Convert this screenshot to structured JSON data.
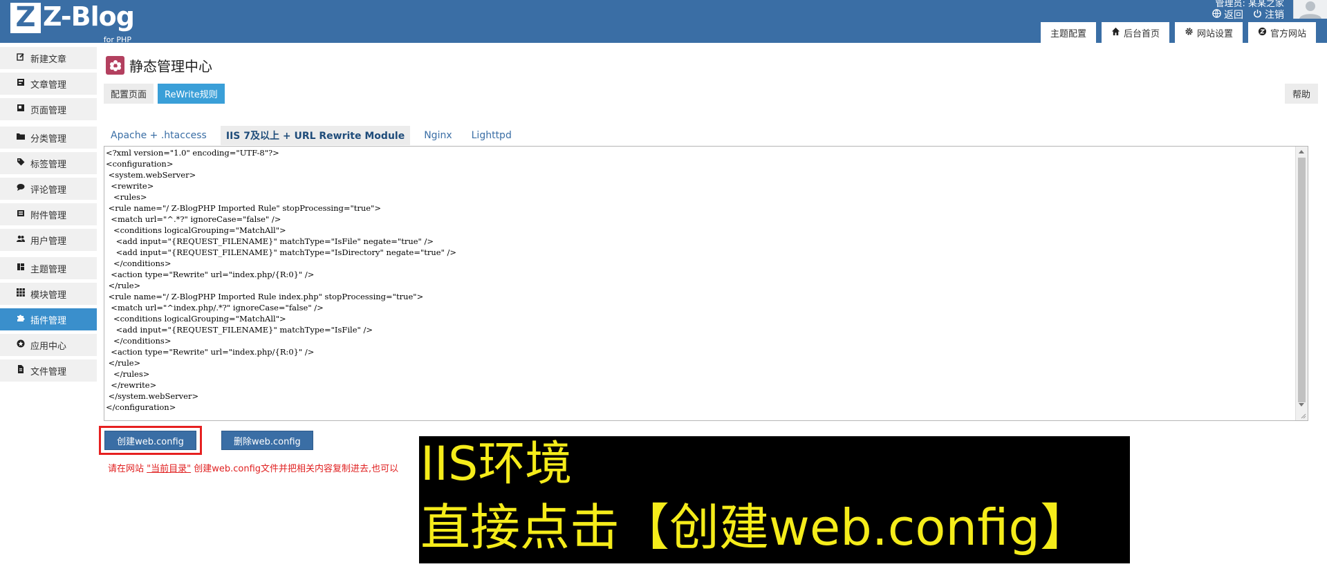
{
  "header": {
    "logo_letter": "Z",
    "logo_text": "Z-Blog",
    "logo_sub": "for PHP",
    "admin_label": "管理员: 某某之家",
    "links": [
      {
        "label": "返回",
        "icon": "globe-icon"
      },
      {
        "label": "注销",
        "icon": "power-icon"
      }
    ],
    "nav_tabs": [
      {
        "label": "主题配置",
        "icon": ""
      },
      {
        "label": "后台首页",
        "icon": "home-icon"
      },
      {
        "label": "网站设置",
        "icon": "gear-icon"
      },
      {
        "label": "官方网站",
        "icon": "zblog-icon"
      }
    ]
  },
  "sidebar": {
    "items": [
      {
        "label": "新建文章",
        "icon": "edit-icon"
      },
      {
        "label": "文章管理",
        "icon": "article-icon"
      },
      {
        "label": "页面管理",
        "icon": "page-icon"
      },
      {
        "label": "分类管理",
        "icon": "folder-icon"
      },
      {
        "label": "标签管理",
        "icon": "tag-icon"
      },
      {
        "label": "评论管理",
        "icon": "comment-icon"
      },
      {
        "label": "附件管理",
        "icon": "attachment-icon"
      },
      {
        "label": "用户管理",
        "icon": "users-icon"
      },
      {
        "label": "主题管理",
        "icon": "theme-icon"
      },
      {
        "label": "模块管理",
        "icon": "grid-icon"
      },
      {
        "label": "插件管理",
        "icon": "puzzle-icon",
        "active": true
      },
      {
        "label": "应用中心",
        "icon": "app-center-icon"
      },
      {
        "label": "文件管理",
        "icon": "file-icon"
      }
    ]
  },
  "main": {
    "title": "静态管理中心",
    "subtabs": [
      {
        "label": "配置页面",
        "active": false
      },
      {
        "label": "ReWrite规则",
        "active": true
      }
    ],
    "help_label": "帮助",
    "server_tabs": [
      {
        "label": "Apache + .htaccess",
        "active": false
      },
      {
        "label": "IIS 7及以上 + URL Rewrite Module",
        "active": true
      },
      {
        "label": "Nginx",
        "active": false
      },
      {
        "label": "Lighttpd",
        "active": false
      }
    ],
    "code": "<?xml version=\"1.0\" encoding=\"UTF-8\"?>\n<configuration>\n <system.webServer>\n  <rewrite>\n   <rules>\n <rule name=\"/ Z-BlogPHP Imported Rule\" stopProcessing=\"true\">\n  <match url=\"^.*?\" ignoreCase=\"false\" />\n   <conditions logicalGrouping=\"MatchAll\">\n    <add input=\"{REQUEST_FILENAME}\" matchType=\"IsFile\" negate=\"true\" />\n    <add input=\"{REQUEST_FILENAME}\" matchType=\"IsDirectory\" negate=\"true\" />\n   </conditions>\n  <action type=\"Rewrite\" url=\"index.php/{R:0}\" />\n </rule>\n <rule name=\"/ Z-BlogPHP Imported Rule index.php\" stopProcessing=\"true\">\n  <match url=\"^index.php/.*?\" ignoreCase=\"false\" />\n   <conditions logicalGrouping=\"MatchAll\">\n    <add input=\"{REQUEST_FILENAME}\" matchType=\"IsFile\" />\n   </conditions>\n  <action type=\"Rewrite\" url=\"index.php/{R:0}\" />\n </rule>\n   </rules>\n  </rewrite>\n </system.webServer>\n</configuration>",
    "create_button": "创建web.config",
    "delete_button": "删除web.config",
    "hint_prefix": "请在网站 ",
    "hint_link": "\"当前目录\"",
    "hint_suffix": " 创建web.config文件并把相关内容复制进去,也可以"
  },
  "overlay": {
    "line1": "IIS环境",
    "line2": "直接点击【创建web.config】"
  },
  "colors": {
    "header_bg": "#3a6ea5",
    "active_blue": "#3a8fcc",
    "highlight_red": "#e62020",
    "overlay_text": "#f5ec1a"
  }
}
